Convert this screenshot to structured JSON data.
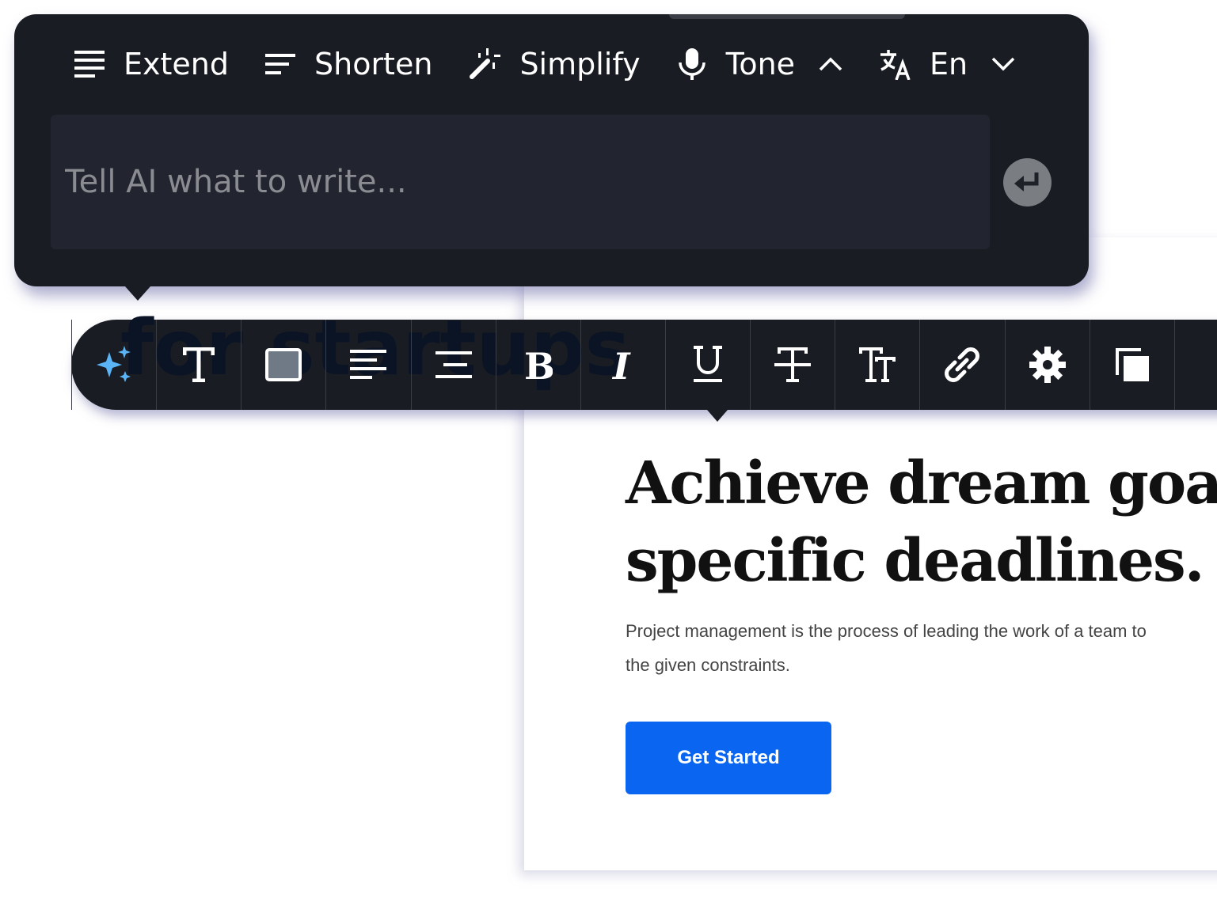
{
  "ai_panel": {
    "actions": [
      {
        "label": "Extend",
        "icon": "lines-icon"
      },
      {
        "label": "Shorten",
        "icon": "short-lines-icon"
      },
      {
        "label": "Simplify",
        "icon": "magic-wand-icon"
      },
      {
        "label": "Tone",
        "icon": "microphone-icon"
      },
      {
        "label": "En",
        "icon": "translate-icon"
      }
    ],
    "input_placeholder": "Tell AI what to write...",
    "submit_icon": "enter-icon"
  },
  "toolbar": {
    "background_text": "for startups",
    "tools": [
      "ai-sparkle",
      "text",
      "background-color",
      "align-left",
      "align-center",
      "bold",
      "italic",
      "underline",
      "strikethrough",
      "font-size",
      "link",
      "settings",
      "duplicate"
    ],
    "accent": "#5ab4f5"
  },
  "content": {
    "heading_line1": "Achieve dream goals",
    "heading_line2": "specific deadlines.",
    "paragraph_line1": "Project management is the process of leading the work of a team to",
    "paragraph_line2": "the given constraints.",
    "cta_label": "Get Started",
    "cta_color": "#0a66f0"
  }
}
